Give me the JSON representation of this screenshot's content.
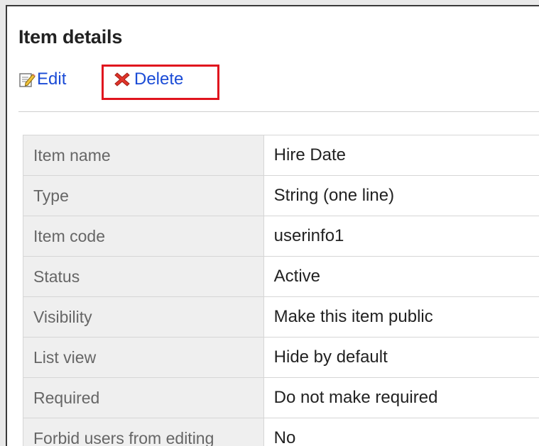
{
  "page": {
    "title": "Item details"
  },
  "actions": {
    "edit_label": "Edit",
    "delete_label": "Delete",
    "highlight_color": "#e0141e",
    "link_color": "#1a4bd6"
  },
  "details": {
    "rows": [
      {
        "label": "Item name",
        "value": "Hire Date"
      },
      {
        "label": "Type",
        "value": "String (one line)"
      },
      {
        "label": "Item code",
        "value": "userinfo1"
      },
      {
        "label": "Status",
        "value": "Active"
      },
      {
        "label": "Visibility",
        "value": "Make this item public"
      },
      {
        "label": "List view",
        "value": "Hide by default"
      },
      {
        "label": "Required",
        "value": "Do not make required"
      },
      {
        "label": "Forbid users from editing",
        "value": "No"
      }
    ]
  }
}
